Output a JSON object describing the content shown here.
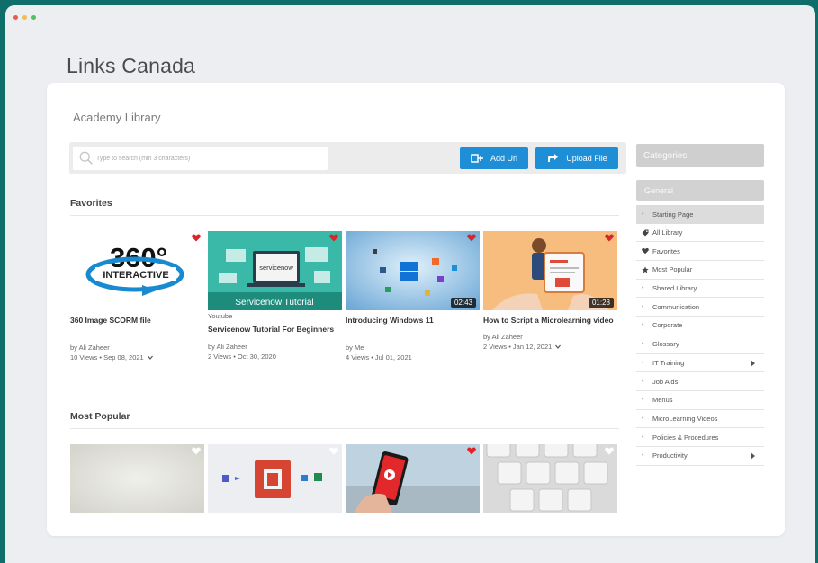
{
  "window": {
    "dots": [
      "#e85a4f",
      "#f2bd4f",
      "#4ec162"
    ]
  },
  "page_title": "Links Canada",
  "library": {
    "title": "Academy Library",
    "search_placeholder": "Type to search (min 3 characters)",
    "add_url_label": "Add Url",
    "upload_label": "Upload File"
  },
  "favorites": {
    "label": "Favorites",
    "items": [
      {
        "title": "360 Image SCORM file",
        "source": "",
        "author": "by Ali Zaheer",
        "views": "10 Views • Sep 08, 2021",
        "duration": "",
        "thumb_text": "360°",
        "thumb_subtext": "INTERACTIVE"
      },
      {
        "title": "Servicenow Tutorial For Beginners",
        "source": "Youtube",
        "author": "by Ali Zaheer",
        "views": "2 Views • Oct 30, 2020",
        "duration": "",
        "thumb_text": "Servicenow Tutorial",
        "thumb_subtext": "servicenow"
      },
      {
        "title": "Introducing Windows 11",
        "source": "",
        "author": "by Me",
        "views": "4 Views • Jul 01, 2021",
        "duration": "02:43"
      },
      {
        "title": "How to Script a Microlearning video",
        "source": "",
        "author": "by Ali Zaheer",
        "views": "2 Views • Jan 12, 2021",
        "duration": "01:28"
      }
    ]
  },
  "most_popular": {
    "label": "Most Popular"
  },
  "categories": {
    "header": "Categories",
    "group": "General",
    "items": [
      {
        "label": "Starting Page",
        "icon": "dot"
      },
      {
        "label": "All Library",
        "icon": "tag-icon"
      },
      {
        "label": "Favorites",
        "icon": "heart-icon"
      },
      {
        "label": "Most Popular",
        "icon": "star-icon"
      },
      {
        "label": "Shared Library",
        "icon": "dot"
      },
      {
        "label": "Communication",
        "icon": "dot"
      },
      {
        "label": "Corporate",
        "icon": "dot"
      },
      {
        "label": "Glossary",
        "icon": "dot"
      },
      {
        "label": "IT Training",
        "icon": "dot"
      },
      {
        "label": "Job Aids",
        "icon": "dot"
      },
      {
        "label": "Menus",
        "icon": "dot"
      },
      {
        "label": "MicroLearning Videos",
        "icon": "dot"
      },
      {
        "label": "Policies & Procedures",
        "icon": "dot"
      },
      {
        "label": "Productivity",
        "icon": "dot"
      }
    ]
  },
  "colors": {
    "accent_blue": "#1e8fd6",
    "heart_red": "#d9262b",
    "background_teal": "#0f6e6a"
  }
}
